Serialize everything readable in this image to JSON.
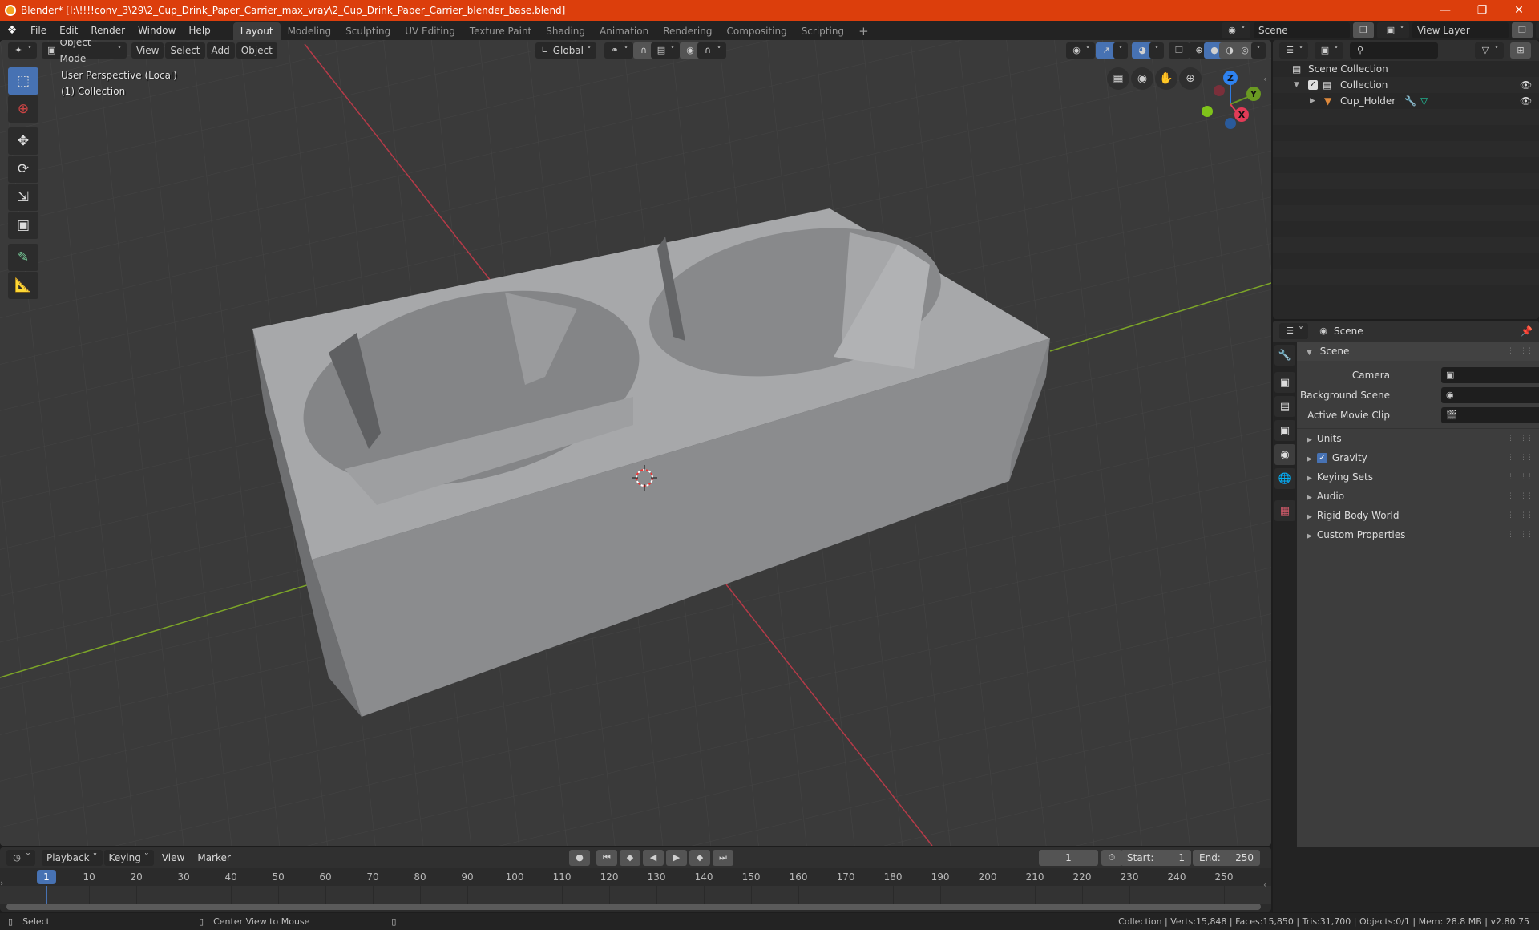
{
  "window": {
    "title": "Blender* [I:\\!!!!conv_3\\29\\2_Cup_Drink_Paper_Carrier_max_vray\\2_Cup_Drink_Paper_Carrier_blender_base.blend]",
    "minimize_icon": "minimize-icon",
    "maximize_icon": "restore-icon",
    "close_icon": "close-icon"
  },
  "menubar": {
    "menus": [
      "File",
      "Edit",
      "Render",
      "Window",
      "Help"
    ],
    "workspaces": [
      "Layout",
      "Modeling",
      "Sculpting",
      "UV Editing",
      "Texture Paint",
      "Shading",
      "Animation",
      "Rendering",
      "Compositing",
      "Scripting"
    ],
    "active_workspace": "Layout",
    "add_workspace": "+",
    "scene_label": "Scene",
    "view_layer_label": "View Layer"
  },
  "viewport_header": {
    "mode": "Object Mode",
    "menus": [
      "View",
      "Select",
      "Add",
      "Object"
    ],
    "orientation": "Global"
  },
  "viewport": {
    "perspective_label": "User Perspective (Local)",
    "collection_label": "(1) Collection",
    "gizmo": {
      "z": "Z",
      "y": "Y",
      "x": "X"
    },
    "object_name": "Cup_Holder",
    "colors": {
      "background": "#3a3a3a",
      "x_axis": "#c0404e",
      "y_axis": "#7ca528",
      "mesh_top": "#a8a9ab",
      "mesh_front": "#8a8b8d",
      "mesh_side": "#737476"
    }
  },
  "outliner": {
    "rows": [
      {
        "label": "Scene Collection",
        "icon": "scene-collection-icon"
      },
      {
        "label": "Collection",
        "icon": "collection-icon",
        "checked": true
      },
      {
        "label": "Cup_Holder",
        "icon": "mesh-object-icon"
      }
    ]
  },
  "properties": {
    "header_title": "Scene",
    "panel_title": "Scene",
    "fields": [
      {
        "label": "Camera",
        "value": ""
      },
      {
        "label": "Background Scene",
        "value": ""
      },
      {
        "label": "Active Movie Clip",
        "value": ""
      }
    ],
    "subpanels": [
      "Units",
      "Gravity",
      "Keying Sets",
      "Audio",
      "Rigid Body World",
      "Custom Properties"
    ],
    "gravity_checked": true
  },
  "timeline": {
    "menus": [
      "Playback",
      "Keying",
      "View",
      "Marker"
    ],
    "current_frame": "1",
    "start_label": "Start:",
    "start": "1",
    "end_label": "End:",
    "end": "250",
    "ticks": [
      "10",
      "20",
      "30",
      "40",
      "50",
      "60",
      "70",
      "80",
      "90",
      "100",
      "110",
      "120",
      "130",
      "140",
      "150",
      "160",
      "170",
      "180",
      "190",
      "200",
      "210",
      "220",
      "230",
      "240",
      "250"
    ],
    "playhead_label": "1"
  },
  "statusbar": {
    "select": "Select",
    "center_view": "Center View to Mouse",
    "stats": "Collection | Verts:15,848 | Faces:15,850 | Tris:31,700 | Objects:0/1 | Mem: 28.8 MB | v2.80.75"
  }
}
